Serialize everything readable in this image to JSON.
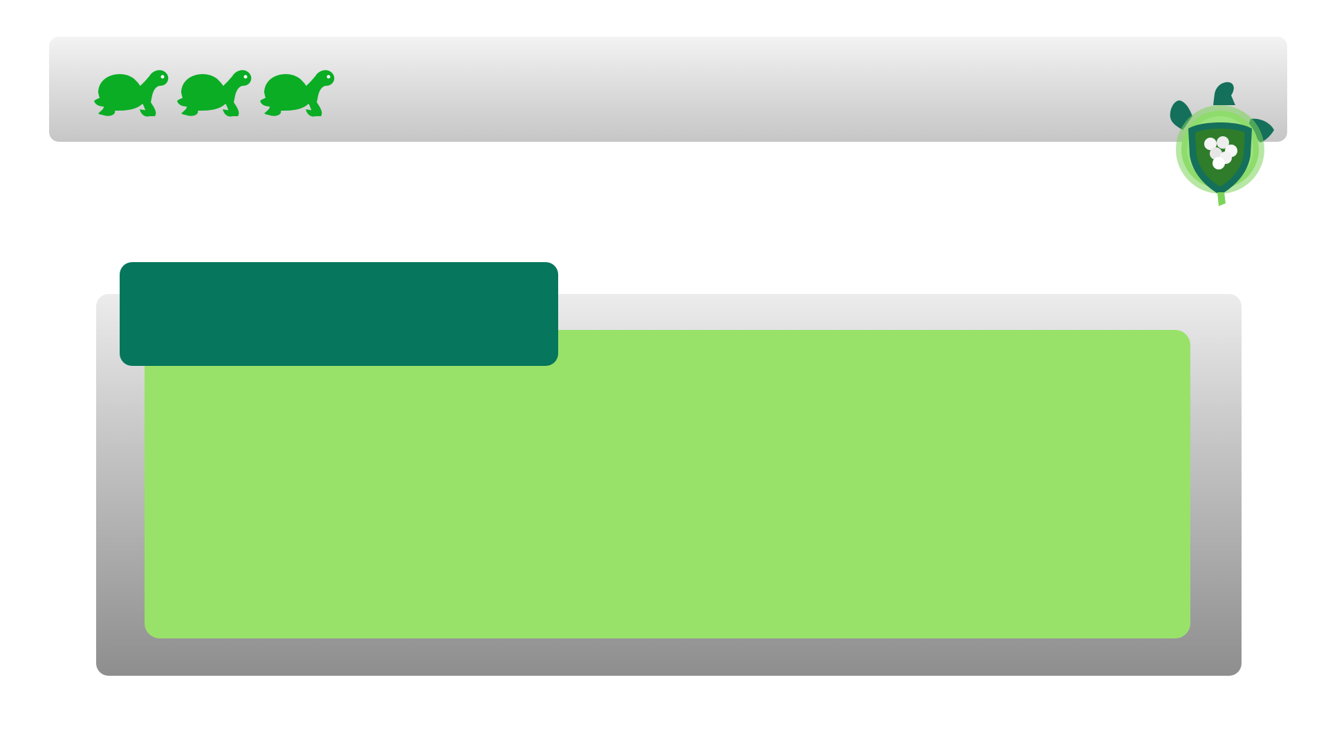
{
  "header": {
    "turtle_icons": [
      "turtle-icon",
      "turtle-icon",
      "turtle-icon"
    ],
    "emblem_icon": "turtle-shield-emblem-icon"
  },
  "panel": {
    "title": "",
    "body": ""
  },
  "colors": {
    "turtle_green": "#0aad24",
    "title_tab": "#06765c",
    "content_area": "#99e26a",
    "emblem_dark": "#14705a",
    "emblem_light": "#7cd45a"
  }
}
